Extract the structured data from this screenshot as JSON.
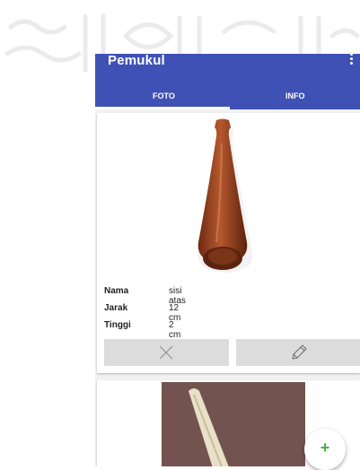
{
  "app_bar": {
    "title": "Pemukul",
    "overflow_icon": "more-vert-icon"
  },
  "tabs": [
    {
      "label": "FOTO",
      "selected": true
    },
    {
      "label": "INFO",
      "selected": false
    }
  ],
  "items": [
    {
      "image": "wooden-bat-photo",
      "fields": [
        {
          "label": "Nama",
          "value": "sisi atas"
        },
        {
          "label": "Jarak",
          "value": "12 cm"
        },
        {
          "label": "Tinggi",
          "value": "2 cm"
        }
      ],
      "actions": [
        {
          "icon": "close-icon"
        },
        {
          "icon": "pencil-icon"
        }
      ]
    },
    {
      "image": "bat-photo"
    }
  ],
  "fab": {
    "label": "+",
    "icon": "add-icon"
  },
  "colors": {
    "primary": "#3f51b5",
    "accent": "#4caf50",
    "button_bg": "#dcdcdc"
  }
}
